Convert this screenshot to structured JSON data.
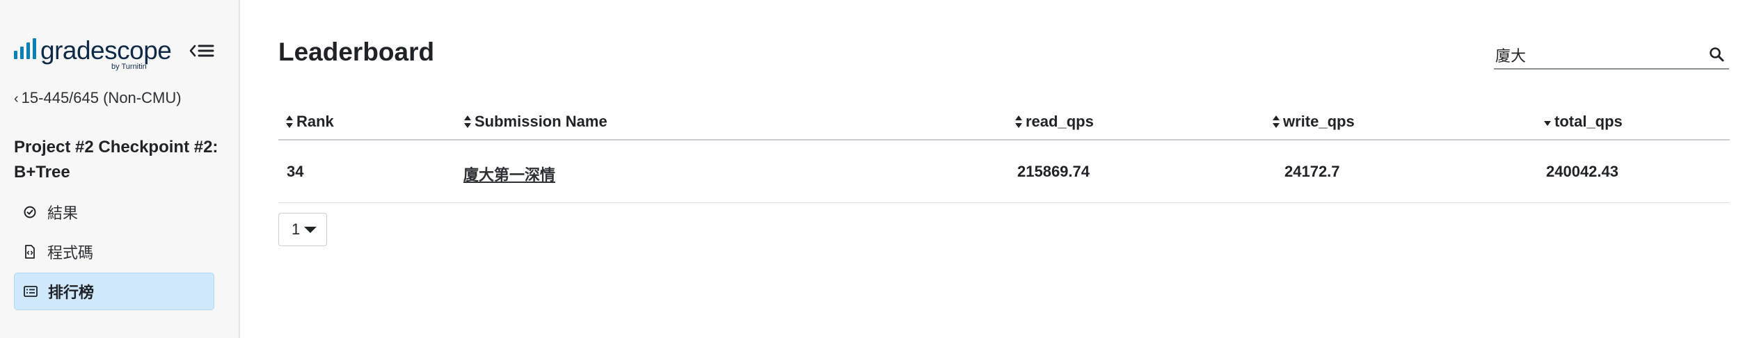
{
  "logo": {
    "text": "gradescope",
    "sub": "by Turnitin"
  },
  "sidebar": {
    "course_link": "15-445/645 (Non-CMU)",
    "assignment_title": "Project #2 Checkpoint #2: B+Tree",
    "items": [
      {
        "label": "結果",
        "icon": "check-circle-icon",
        "active": false
      },
      {
        "label": "程式碼",
        "icon": "code-file-icon",
        "active": false
      },
      {
        "label": "排行榜",
        "icon": "leaderboard-icon",
        "active": true
      }
    ]
  },
  "main": {
    "title": "Leaderboard",
    "search": {
      "value": "廈大",
      "placeholder": ""
    }
  },
  "table": {
    "columns": [
      "Rank",
      "Submission Name",
      "read_qps",
      "write_qps",
      "total_qps"
    ],
    "sorted_column": "total_qps",
    "sort_direction": "descending",
    "rows": [
      {
        "rank": "34",
        "name": "廈大第一深情",
        "read_qps": "215869.74",
        "write_qps": "24172.7",
        "total_qps": "240042.43"
      }
    ]
  },
  "pagination": {
    "current_page": "1"
  },
  "colors": {
    "accent": "#0a7fb8",
    "active_bg": "#cfe8fb",
    "sidebar_bg": "#f7f7f8"
  }
}
